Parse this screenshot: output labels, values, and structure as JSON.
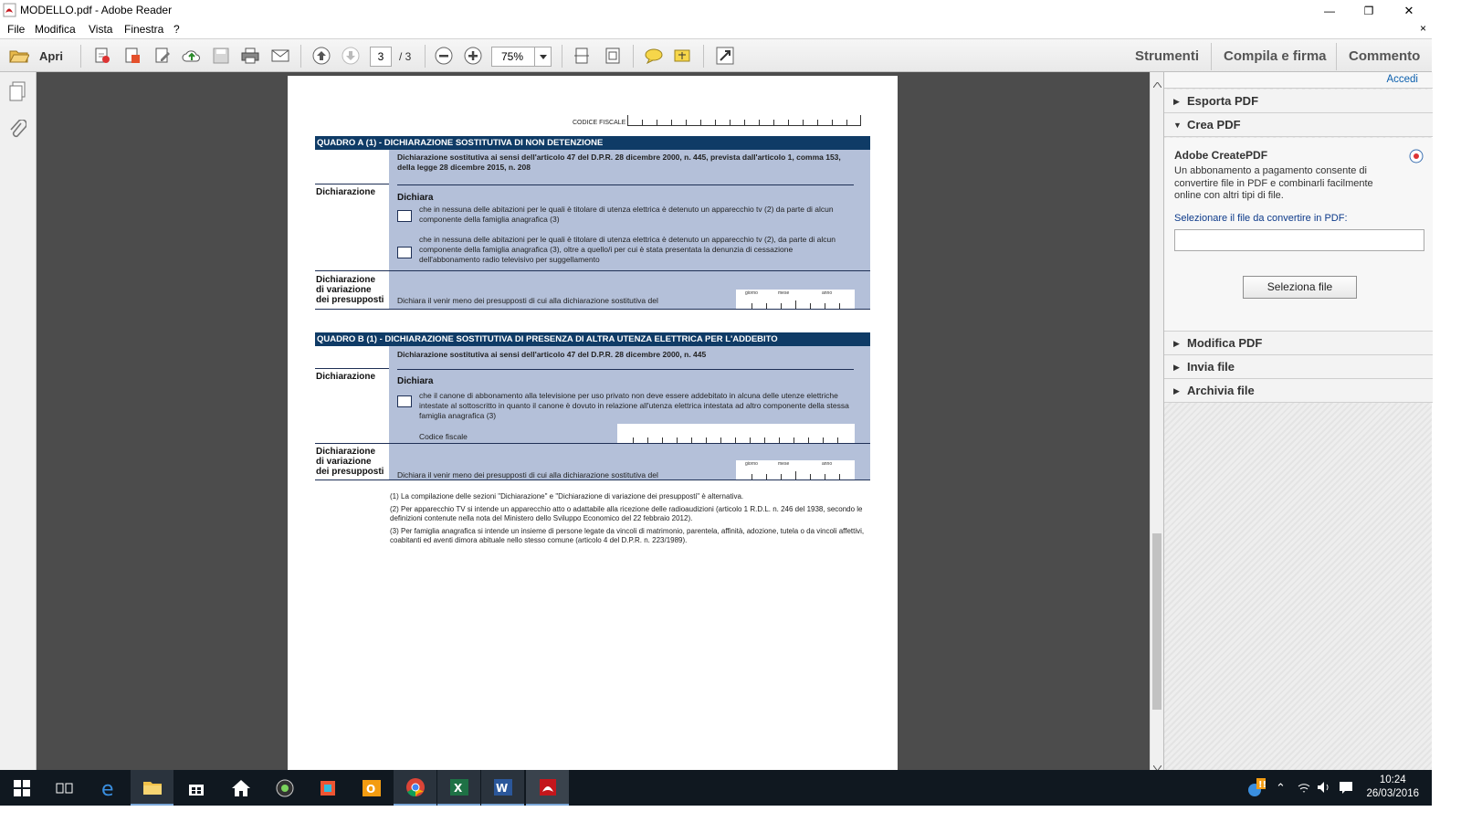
{
  "window": {
    "title": "MODELLO.pdf - Adobe Reader",
    "minimize": "—",
    "restore": "❐",
    "close": "✕"
  },
  "menubar": {
    "items": [
      "File",
      "Modifica",
      "Vista",
      "Finestra",
      "?"
    ],
    "close_x": "×"
  },
  "toolbar": {
    "open_label": "Apri",
    "current_page": "3",
    "page_total": "/ 3",
    "zoom": "75%",
    "tabs": [
      "Strumenti",
      "Compila e firma",
      "Commento"
    ]
  },
  "document": {
    "codice_fiscale_label": "CODICE FISCALE",
    "quadro_a": {
      "header": "QUADRO A (1) - DICHIARAZIONE SOSTITUTIVA DI NON DETENZIONE",
      "intro": "Dichiarazione sostitutiva ai sensi dell'articolo 47 del D.P.R. 28 dicembre 2000, n. 445, prevista dall'articolo 1, comma 153, della legge 28 dicembre 2015, n. 208",
      "row1_label": "Dichiarazione",
      "dichiara": "Dichiara",
      "option1": "che in nessuna delle abitazioni per le quali è titolare di utenza elettrica è detenuto un apparecchio tv (2) da parte di alcun componente della famiglia anagrafica (3)",
      "option2": "che in nessuna delle abitazioni per le quali è titolare di utenza elettrica è detenuto un apparecchio tv (2), da parte di alcun componente della famiglia anagrafica (3), oltre a quello/i per cui è stata presentata la denunzia di cessazione dell'abbonamento radio televisivo per suggellamento",
      "row2_label": "Dichiarazione di variazione dei presupposti",
      "variation_text": "Dichiara il venir meno dei presupposti di cui alla dichiarazione sostitutiva del"
    },
    "quadro_b": {
      "header": "QUADRO B (1) - DICHIARAZIONE SOSTITUTIVA DI PRESENZA DI ALTRA UTENZA ELETTRICA PER L'ADDEBITO",
      "intro": "Dichiarazione sostitutiva ai sensi dell'articolo 47 del D.P.R. 28 dicembre 2000, n. 445",
      "row1_label": "Dichiarazione",
      "dichiara": "Dichiara",
      "option1": "che il canone di abbonamento alla televisione per uso privato non deve essere addebitato in alcuna delle utenze elettriche intestate al sottoscritto in quanto il canone è dovuto in relazione all'utenza elettrica intestata ad altro componente della stessa famiglia anagrafica (3)",
      "codice_fiscale": "Codice fiscale",
      "row2_label": "Dichiarazione di variazione dei presupposti",
      "variation_text": "Dichiara il venir meno dei presupposti di cui alla dichiarazione sostitutiva del"
    },
    "date_labels": [
      "giorno",
      "mese",
      "anno"
    ],
    "footnotes": [
      "(1) La compilazione delle sezioni \"Dichiarazione\" e \"Dichiarazione di variazione dei presupposti\" è alternativa.",
      "(2) Per apparecchio TV si intende un apparecchio atto o adattabile alla ricezione delle radioaudizioni (articolo 1 R.D.L. n. 246 del 1938, secondo le definizioni contenute nella nota del Ministero dello Sviluppo Economico del 22 febbraio 2012).",
      "(3) Per famiglia anagrafica si intende un insieme di persone legate da vincoli di matrimonio, parentela, affinità, adozione, tutela o da vincoli affettivi, coabitanti ed aventi dimora abituale nello stesso comune (articolo 4 del D.P.R. n. 223/1989)."
    ]
  },
  "right_pane": {
    "login": "Accedi",
    "sections": [
      "Esporta PDF",
      "Crea PDF",
      "Modifica PDF",
      "Invia file",
      "Archivia file"
    ],
    "create": {
      "title": "Adobe CreatePDF",
      "description": "Un abbonamento a pagamento consente di convertire file in PDF e combinarli facilmente online con altri tipi di file.",
      "select_label": "Selezionare il file da convertire in PDF:",
      "file_value": "",
      "button": "Seleziona file"
    }
  },
  "taskbar": {
    "time": "10:24",
    "date": "26/03/2016"
  },
  "colors": {
    "header_bar": "#0f3b66",
    "form_panel": "#b4c0d9",
    "document_bg": "#4c4c4c",
    "link": "#0b5fad"
  }
}
